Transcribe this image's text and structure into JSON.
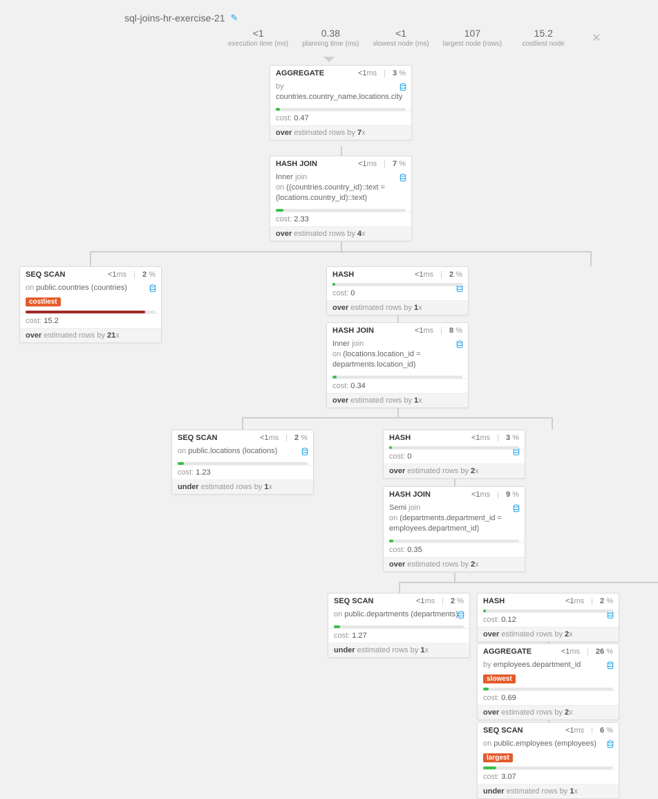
{
  "title": "sql-joins-hr-exercise-21",
  "stats": [
    {
      "value": "<1",
      "label": "execution time (ms)"
    },
    {
      "value": "0.38",
      "label": "planning time (ms)"
    },
    {
      "value": "<1",
      "label": "slowest node (ms)"
    },
    {
      "value": "107",
      "label": "largest node (rows)"
    },
    {
      "value": "15.2",
      "label": "costliest node"
    }
  ],
  "nodes": {
    "agg1": {
      "name": "AGGREGATE",
      "ms": "<1",
      "pct": "3",
      "by_pre": "by ",
      "by": "countries.country_name,locations.city",
      "cost": "0.47",
      "est_dir": "over",
      "est_by": "7",
      "bar_w": "3%",
      "bar_c": "#3bbf4a"
    },
    "hj1": {
      "name": "HASH JOIN",
      "ms": "<1",
      "pct": "7",
      "jtype": "Inner",
      "jword": " join",
      "on_pre": "on ",
      "on": "((countries.country_id)::text = (locations.country_id)::text)",
      "cost": "2.33",
      "est_dir": "over",
      "est_by": "4",
      "bar_w": "6%",
      "bar_c": "#3bbf4a"
    },
    "ss_countries": {
      "name": "SEQ SCAN",
      "ms": "<1",
      "pct": "2",
      "on_pre": "on ",
      "on": "public.countries (countries)",
      "tag": "costliest",
      "cost": "15.2",
      "est_dir": "over",
      "est_by": "21",
      "bar_w": "92%",
      "bar_c": "#9f2a2a"
    },
    "hash1": {
      "name": "HASH",
      "ms": "<1",
      "pct": "2",
      "cost": "0",
      "est_dir": "over",
      "est_by": "1",
      "bar_w": "2%",
      "bar_c": "#3bbf4a"
    },
    "hj2": {
      "name": "HASH JOIN",
      "ms": "<1",
      "pct": "8",
      "jtype": "Inner",
      "jword": " join",
      "on_pre": "on ",
      "on": "(locations.location_id = departments.location_id)",
      "cost": "0.34",
      "est_dir": "over",
      "est_by": "1",
      "bar_w": "3%",
      "bar_c": "#3bbf4a"
    },
    "ss_locations": {
      "name": "SEQ SCAN",
      "ms": "<1",
      "pct": "2",
      "on_pre": "on ",
      "on": "public.locations (locations)",
      "cost": "1.23",
      "est_dir": "under",
      "est_by": "1",
      "bar_w": "5%",
      "bar_c": "#3bbf4a"
    },
    "hash2": {
      "name": "HASH",
      "ms": "<1",
      "pct": "3",
      "cost": "0",
      "est_dir": "over",
      "est_by": "2",
      "bar_w": "2%",
      "bar_c": "#3bbf4a"
    },
    "hj3": {
      "name": "HASH JOIN",
      "ms": "<1",
      "pct": "9",
      "jtype": "Semi",
      "jword": " join",
      "on_pre": "on ",
      "on": "(departments.department_id = employees.department_id)",
      "cost": "0.35",
      "est_dir": "over",
      "est_by": "2",
      "bar_w": "3%",
      "bar_c": "#3bbf4a"
    },
    "ss_departments": {
      "name": "SEQ SCAN",
      "ms": "<1",
      "pct": "2",
      "on_pre": "on ",
      "on": "public.departments (departments)",
      "cost": "1.27",
      "est_dir": "under",
      "est_by": "1",
      "bar_w": "5%",
      "bar_c": "#3bbf4a"
    },
    "hash3": {
      "name": "HASH",
      "ms": "<1",
      "pct": "2",
      "cost": "0.12",
      "est_dir": "over",
      "est_by": "2",
      "bar_w": "2%",
      "bar_c": "#3bbf4a"
    },
    "agg2": {
      "name": "AGGREGATE",
      "ms": "<1",
      "pct": "26",
      "by_pre": "by ",
      "by": "employees.department_id",
      "tag": "slowest",
      "cost": "0.69",
      "est_dir": "over",
      "est_by": "2",
      "bar_w": "4%",
      "bar_c": "#3bbf4a"
    },
    "ss_employees": {
      "name": "SEQ SCAN",
      "ms": "<1",
      "pct": "6",
      "on_pre": "on ",
      "on": "public.employees (employees)",
      "tag": "largest",
      "cost": "3.07",
      "est_dir": "under",
      "est_by": "1",
      "bar_w": "10%",
      "bar_c": "#3bbf4a"
    }
  },
  "ui": {
    "ms_suffix": "ms",
    "pct_suffix": " %",
    "x_suffix": "x",
    "cost_label": "cost: ",
    "est_mid": " estimated rows by "
  }
}
